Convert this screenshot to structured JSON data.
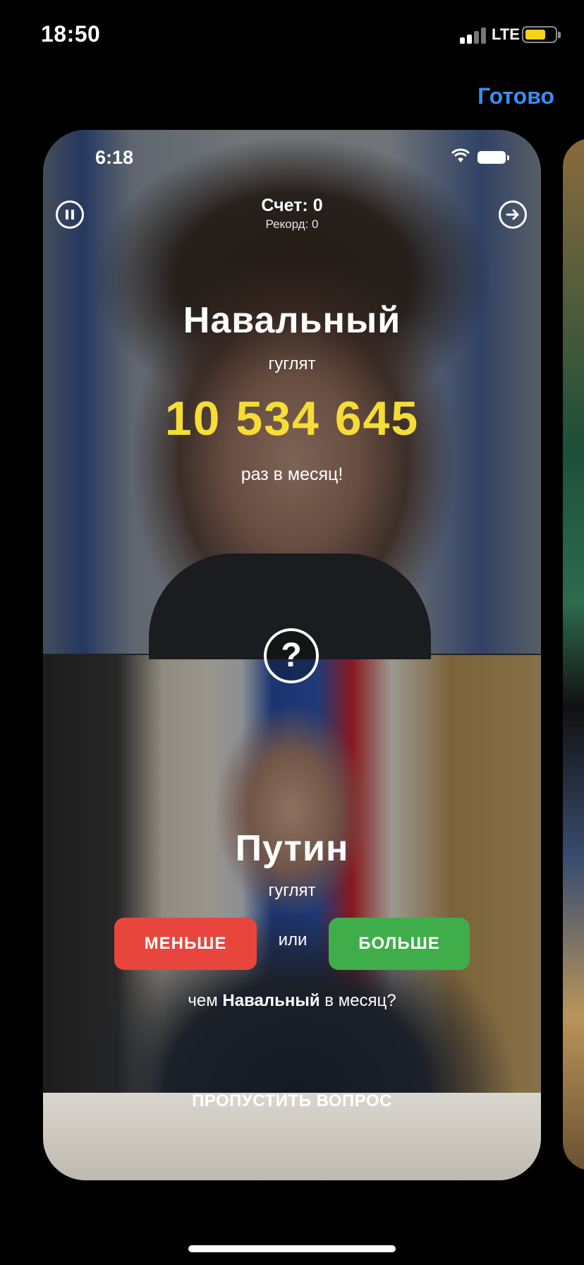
{
  "status_bar": {
    "time": "18:50",
    "network": "LTE",
    "battery_color": "#f7d21d"
  },
  "nav": {
    "done_label": "Готово"
  },
  "preview": {
    "inner_status": {
      "time": "6:18"
    },
    "score_label": "Счет: 0",
    "record_label": "Рекорд: 0",
    "top": {
      "name": "Навальный",
      "googled": "гуглят",
      "count": "10 534 645",
      "per_month": "раз в месяц!"
    },
    "question_mark": "?",
    "bottom": {
      "name": "Путин",
      "googled": "гуглят",
      "less_label": "МЕНЬШЕ",
      "or_label": "или",
      "more_label": "БОЛЬШЕ",
      "compare_prefix": "чем",
      "compare_name": "Навальный",
      "compare_suffix": "в месяц?",
      "skip_label": "ПРОПУСТИТЬ ВОПРОС"
    },
    "colors": {
      "count": "#f6dd35",
      "less": "#e8463d",
      "more": "#3fae4a",
      "done": "#3a8ef0"
    }
  }
}
